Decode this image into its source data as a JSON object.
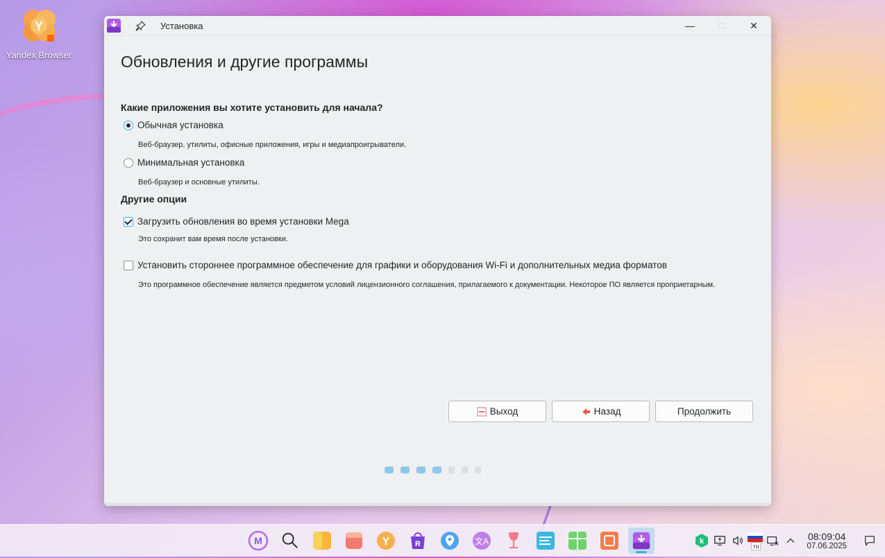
{
  "desktop": {
    "icon_label": "Yandex Browser"
  },
  "window": {
    "title": "Установка",
    "page_title": "Обновления и другие программы"
  },
  "install_type": {
    "heading": "Какие приложения вы хотите установить для начала?",
    "options": [
      {
        "label": "Обычная установка",
        "desc": "Веб-браузер, утилиты, офисные приложения, игры и медиапроигрыватели.",
        "selected": true
      },
      {
        "label": "Минимальная установка",
        "desc": "Веб-браузер и основные утилиты.",
        "selected": false
      }
    ]
  },
  "other": {
    "heading": "Другие опции",
    "options": [
      {
        "label": "Загрузить обновления во время установки Mega",
        "desc": "Это сохранит вам время после установки.",
        "checked": true
      },
      {
        "label": "Установить стороннее программное обеспечение для графики и оборудования Wi-Fi и дополнительных медиа форматов",
        "desc": "Это программное обеспечение является предметом условий лицензионного соглашения, прилагаемого к документации. Некоторое ПО является проприетарным.",
        "checked": false
      }
    ]
  },
  "buttons": {
    "quit": "Выход",
    "back": "Назад",
    "continue": "Продолжить"
  },
  "progress": {
    "done_steps": 4,
    "total_steps": 7
  },
  "taskbar": {
    "apps": [
      "launcher-icon",
      "search-icon",
      "files-icon",
      "store-icon",
      "yandex-browser-icon",
      "rustore-icon",
      "maps-icon",
      "translate-icon",
      "wine-icon",
      "notes-icon",
      "sheets-icon",
      "slides-icon",
      "installer-icon"
    ],
    "lang": "ru",
    "time": "08:09:04",
    "date": "07.06.2025"
  },
  "colors": {
    "accent": "#3daee9",
    "window_bg": "#eff0f1"
  }
}
